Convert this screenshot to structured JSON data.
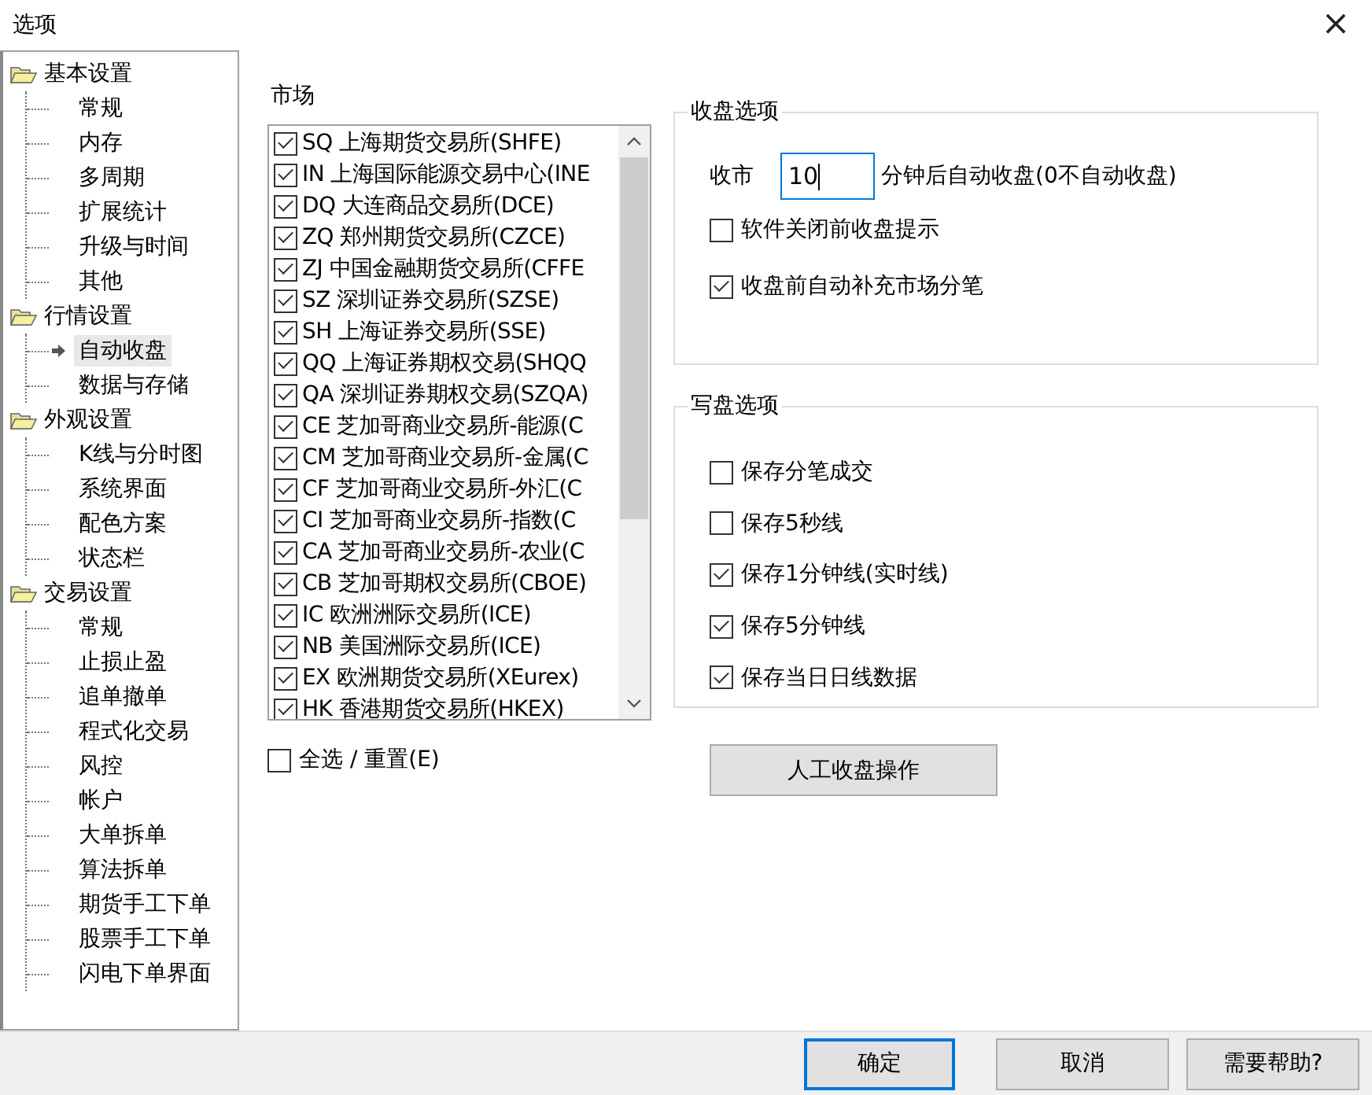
{
  "window": {
    "title": "选项",
    "close": "×"
  },
  "sidebar": {
    "groups": [
      {
        "label": "基本设置",
        "children": [
          {
            "label": "常规",
            "selected": false
          },
          {
            "label": "内存",
            "selected": false
          },
          {
            "label": "多周期",
            "selected": false
          },
          {
            "label": "扩展统计",
            "selected": false
          },
          {
            "label": "升级与时间",
            "selected": false
          },
          {
            "label": "其他",
            "selected": false
          }
        ]
      },
      {
        "label": "行情设置",
        "children": [
          {
            "label": "自动收盘",
            "selected": true
          },
          {
            "label": "数据与存储",
            "selected": false
          }
        ]
      },
      {
        "label": "外观设置",
        "children": [
          {
            "label": "K线与分时图",
            "selected": false
          },
          {
            "label": "系统界面",
            "selected": false
          },
          {
            "label": "配色方案",
            "selected": false
          },
          {
            "label": "状态栏",
            "selected": false
          }
        ]
      },
      {
        "label": "交易设置",
        "children": [
          {
            "label": "常规",
            "selected": false
          },
          {
            "label": "止损止盈",
            "selected": false
          },
          {
            "label": "追单撤单",
            "selected": false
          },
          {
            "label": "程式化交易",
            "selected": false
          },
          {
            "label": "风控",
            "selected": false
          },
          {
            "label": "帐户",
            "selected": false
          },
          {
            "label": "大单拆单",
            "selected": false
          },
          {
            "label": "算法拆单",
            "selected": false
          },
          {
            "label": "期货手工下单",
            "selected": false
          },
          {
            "label": "股票手工下单",
            "selected": false
          },
          {
            "label": "闪电下单界面",
            "selected": false
          }
        ]
      }
    ]
  },
  "market": {
    "title": "市场",
    "items": [
      {
        "label": "SQ 上海期货交易所(SHFE)",
        "checked": true
      },
      {
        "label": "IN 上海国际能源交易中心(INE",
        "checked": true
      },
      {
        "label": "DQ 大连商品交易所(DCE)",
        "checked": true
      },
      {
        "label": "ZQ 郑州期货交易所(CZCE)",
        "checked": true
      },
      {
        "label": "ZJ 中国金融期货交易所(CFFE",
        "checked": true
      },
      {
        "label": "SZ 深圳证券交易所(SZSE)",
        "checked": true
      },
      {
        "label": "SH 上海证券交易所(SSE)",
        "checked": true
      },
      {
        "label": "QQ 上海证券期权交易(SHQQ",
        "checked": true
      },
      {
        "label": "QA 深圳证券期权交易(SZQA)",
        "checked": true
      },
      {
        "label": "CE 芝加哥商业交易所-能源(C",
        "checked": true
      },
      {
        "label": "CM 芝加哥商业交易所-金属(C",
        "checked": true
      },
      {
        "label": "CF 芝加哥商业交易所-外汇(C",
        "checked": true
      },
      {
        "label": "CI 芝加哥商业交易所-指数(C",
        "checked": true
      },
      {
        "label": "CA 芝加哥商业交易所-农业(C",
        "checked": true
      },
      {
        "label": "CB 芝加哥期权交易所(CBOE)",
        "checked": true
      },
      {
        "label": "IC 欧洲洲际交易所(ICE)",
        "checked": true
      },
      {
        "label": "NB 美国洲际交易所(ICE)",
        "checked": true
      },
      {
        "label": "EX 欧洲期货交易所(XEurex)",
        "checked": true
      },
      {
        "label": "HK 香港期货交易所(HKEX)",
        "checked": true
      }
    ],
    "select_all": {
      "label": "全选 / 重置(E)",
      "checked": false
    }
  },
  "close_options": {
    "title": "收盘选项",
    "close_label": "收市",
    "minutes": "10",
    "minutes_suffix": "分钟后自动收盘(0不自动收盘)",
    "checkboxes": [
      {
        "label": "软件关闭前收盘提示",
        "checked": false
      },
      {
        "label": "收盘前自动补充市场分笔",
        "checked": true
      }
    ]
  },
  "write_options": {
    "title": "写盘选项",
    "checkboxes": [
      {
        "label": "保存分笔成交",
        "checked": false
      },
      {
        "label": "保存5秒线",
        "checked": false
      },
      {
        "label": "保存1分钟线(实时线)",
        "checked": true
      },
      {
        "label": "保存5分钟线",
        "checked": true
      },
      {
        "label": "保存当日日线数据",
        "checked": true
      }
    ]
  },
  "manual_button": "人工收盘操作",
  "buttons": [
    {
      "label": "确定",
      "default": true
    },
    {
      "label": "取消",
      "default": false
    },
    {
      "label": "需要帮助?",
      "default": false
    }
  ]
}
